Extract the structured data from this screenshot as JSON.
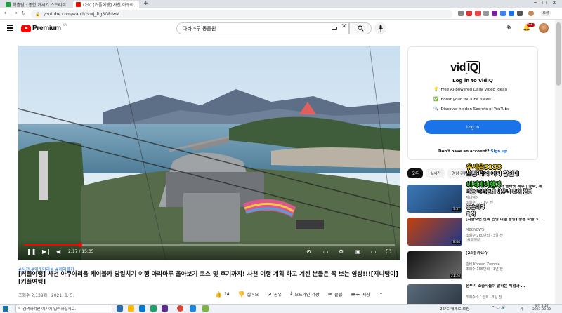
{
  "browser": {
    "tabs": [
      {
        "label": "학흘팀 : 종합 거시기 스트리머",
        "color": "#1a9f3b"
      },
      {
        "label": "(29) [커플여행] 사천 아쿠아...",
        "color": "#ff0000"
      }
    ],
    "new_tab": "+",
    "url": "youtube.com/watch?v=j_ftg3GRfwM"
  },
  "youtube": {
    "logo_text": "Premium",
    "country": "KR",
    "search_value": "아라마루 동물원",
    "notif_count": "9+"
  },
  "player": {
    "current_time": "2:17",
    "duration": "15:05",
    "progress": 0.151
  },
  "video": {
    "tags": "#사천 #아쿠아리움 #케이블카",
    "title": "[커플여행] 사천 아쿠아리움 케이블카 당일치기 여행 아라마루 올아보기 코스 및 후기까지! 사천 여행 계획 하고 계신 분들은 꼭 보는 영상!!![지니탱이] [커플여행]",
    "meta": "조회수 2,139회 · 2021. 8. 5.",
    "actions": {
      "like": "14",
      "dislike": "싫어요",
      "share": "공유",
      "offline": "오프라인 저장",
      "clip": "클립",
      "save": "저장",
      "more": "···"
    }
  },
  "vidiq": {
    "logo_vid": "vid",
    "logo_iq": "IQ",
    "heading": "Log in to vidIQ",
    "features": [
      {
        "icon": "💡",
        "text": "Free AI-powered Daily Video Ideas"
      },
      {
        "icon": "✅",
        "text": "Boost your YouTube Views"
      },
      {
        "icon": "🔍",
        "text": "Discover hidden Secrets of YouTube"
      }
    ],
    "login_label": "Log in",
    "no_account": "Don't have an account?",
    "signup": "Sign up"
  },
  "chips": [
    "모두",
    "실시간",
    "경남 관련 콘텐츠"
  ],
  "recommendations": [
    {
      "title": "제주 아쿠아리움 아쿠아 플라넷 제주 | 공짜, 체험 2시간 반 이상",
      "channel": "지니탱이",
      "meta": "조회수 ... · 1년 전",
      "duration": "3:37",
      "thumb_from": "#3a79b8",
      "thumb_to": "#1f3d66"
    },
    {
      "title": "[지금보면 진짜 인생 여행 영상] 등돈 마을 3...",
      "channel": "MBCNEWS",
      "meta": "조회수 260만회 · 3일 전",
      "duration": "8:44",
      "badge": "새 동영상",
      "thumb_from": "#c2410c",
      "thumb_to": "#1e3a8a"
    },
    {
      "title": "[2화] 카요쥬",
      "channel": "좀비 Korean Zombie",
      "meta": "조회수 156만회 · 1년 전",
      "duration": "21:24",
      "thumb_from": "#141414",
      "thumb_to": "#6b6b6b"
    },
    {
      "title": "전투기 조종사들이 말하는 체험과 ...",
      "channel": "",
      "meta": "조회수 9.1천회 · 3일 전",
      "duration": "",
      "badge": "새 동영상",
      "thumb_from": "#5a6b7a",
      "thumb_to": "#2b3440"
    }
  ],
  "chat_overlay": [
    {
      "text": "유시은3133",
      "color": "yellow"
    },
    {
      "text": "노란 너의 이씨 창인데",
      "color": "white"
    },
    {
      "text": "이세계여행가",
      "color": "green"
    },
    {
      "text": "나는 다니는데 아우니 라이 전생",
      "color": "white"
    },
    {
      "text": "중순이다",
      "color": "white"
    },
    {
      "text": "재혁",
      "color": "white"
    }
  ],
  "taskbar": {
    "search_placeholder": "검색하려면 여기에 입력하십시오.",
    "weather": "26°C 대체로 흐림",
    "ime": "가",
    "time": "오전 2:27",
    "date": "2023-08-30"
  }
}
